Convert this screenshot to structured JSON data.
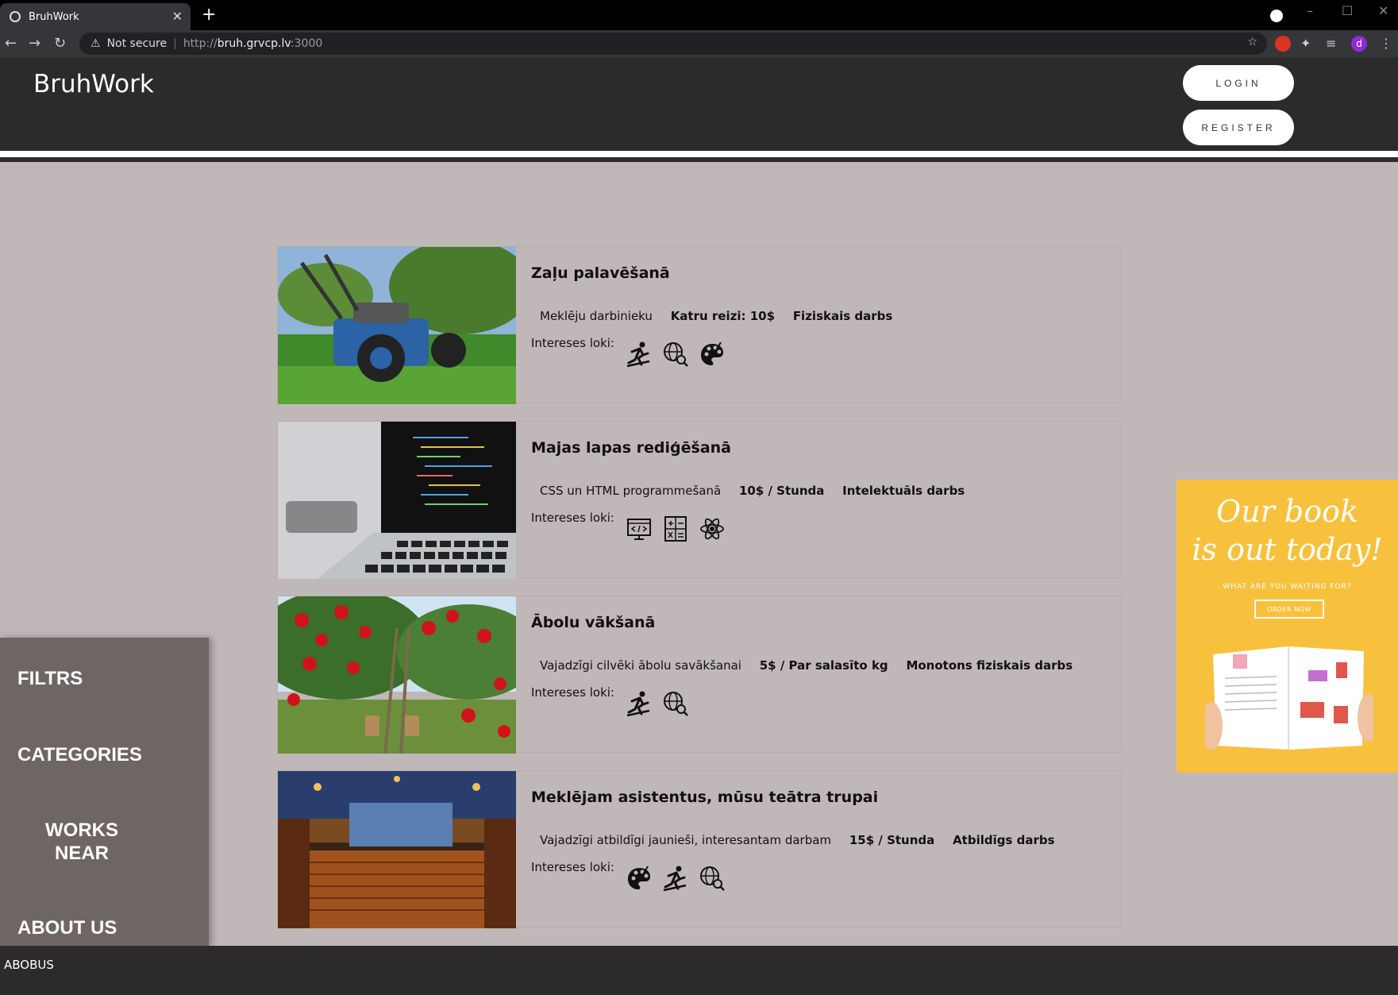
{
  "browser": {
    "tab_title": "BruhWork",
    "security_label": "Not secure",
    "url_prefix": "http://",
    "url_host": "bruh.grvcp.lv",
    "url_suffix": ":3000",
    "profile_initial": "d"
  },
  "header": {
    "logo": "BruhWork",
    "login_label": "LOGIN",
    "register_label": "REGISTER"
  },
  "listings": [
    {
      "title": "Zaļu palavēšanā",
      "description": "Meklēju darbinieku",
      "price": "Katru reizi: 10$",
      "type": "Fiziskais darbs",
      "interests_label": "Intereses loki:",
      "icons": [
        "sport-icon",
        "globe-search-icon",
        "palette-icon"
      ]
    },
    {
      "title": "Majas lapas rediģēšanā",
      "description": "CSS un HTML programmešanā",
      "price": "10$ / Stunda",
      "type": "Intelektuāls darbs",
      "interests_label": "Intereses loki:",
      "icons": [
        "coding-icon",
        "calculator-icon",
        "atom-icon"
      ]
    },
    {
      "title": "Ābolu vākšanā",
      "description": "Vajadzīgi cilvēki ābolu savākšanai",
      "price": "5$ / Par salasīto kg",
      "type": "Monotons fiziskais darbs",
      "interests_label": "Intereses loki:",
      "icons": [
        "sport-icon",
        "globe-search-icon"
      ]
    },
    {
      "title": "Meklējam asistentus, mūsu teātra trupai",
      "description": "Vajadzīgi atbildīgi jaunieši, interesantam darbam",
      "price": "15$ / Stunda",
      "type": "Atbildīgs darbs",
      "interests_label": "Intereses loki:",
      "icons": [
        "palette-icon",
        "sport-icon",
        "globe-search-icon"
      ]
    }
  ],
  "sidebar": {
    "items": [
      "FILTRS",
      "CATEGORIES",
      "WORKS NEAR",
      "ABOUT US"
    ]
  },
  "ad": {
    "headline_line1": "Our book",
    "headline_line2": "is out today!",
    "subline": "WHAT ARE YOU WAITING FOR?",
    "cta": "ORDER NOW"
  },
  "footer": {
    "text": "ABOBUS"
  }
}
